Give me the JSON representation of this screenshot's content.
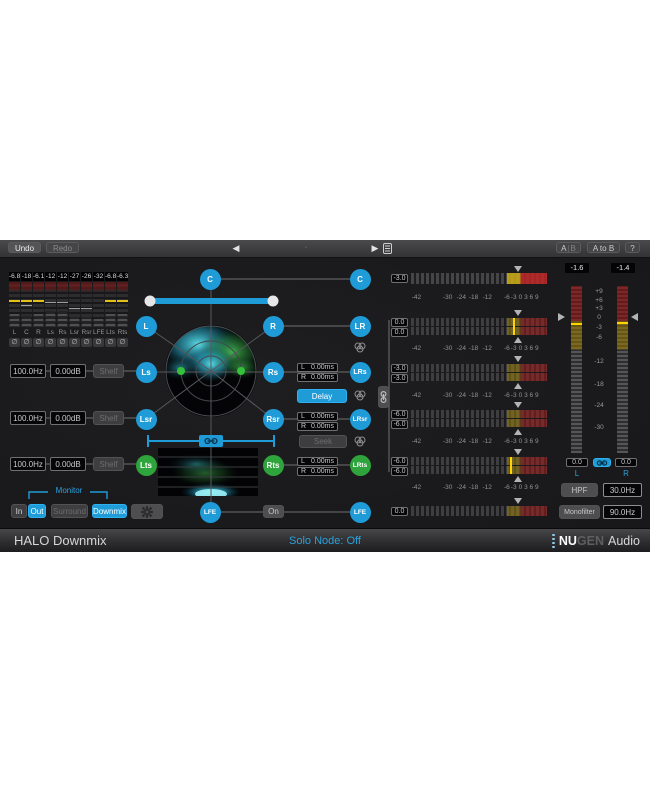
{
  "topbar": {
    "undo": "Undo",
    "redo": "Redo",
    "prev_icon": "◀",
    "dot": "·",
    "play_icon": "▶",
    "ab_a": "A",
    "ab_sep": "|",
    "ab_b": "B",
    "a_to_b": "A to B",
    "help": "?"
  },
  "input_meters": {
    "channels": [
      {
        "label": "L",
        "peak": "-6.8",
        "phase": "∅"
      },
      {
        "label": "C",
        "peak": "-18",
        "phase": "∅"
      },
      {
        "label": "R",
        "peak": "-6.1",
        "phase": "∅"
      },
      {
        "label": "Ls",
        "peak": "-12",
        "phase": "∅"
      },
      {
        "label": "Rs",
        "peak": "-12",
        "phase": "∅"
      },
      {
        "label": "Lsr",
        "peak": "-27",
        "phase": "∅"
      },
      {
        "label": "Rsr",
        "peak": "-26",
        "phase": "∅"
      },
      {
        "label": "LFE",
        "peak": "-32",
        "phase": "∅"
      },
      {
        "label": "Lts",
        "peak": "-6.8",
        "phase": "∅"
      },
      {
        "label": "Rts",
        "peak": "-6.3",
        "phase": "∅"
      }
    ]
  },
  "shelf_rows": [
    {
      "freq": "100.0Hz",
      "gain": "0.00dB",
      "mode": "Shelf"
    },
    {
      "freq": "100.0Hz",
      "gain": "0.00dB",
      "mode": "Shelf"
    },
    {
      "freq": "100.0Hz",
      "gain": "0.00dB",
      "mode": "Shelf"
    }
  ],
  "monitor": {
    "label": "Monitor",
    "in": "In",
    "out": "Out",
    "surround": "Surround",
    "downmix": "Downmix"
  },
  "nodes": {
    "c_in": "C",
    "l": "L",
    "r": "R",
    "ls": "Ls",
    "rs": "Rs",
    "lsr": "Lsr",
    "rsr": "Rsr",
    "lts": "Lts",
    "rts": "Rts",
    "lfe_in": "LFE",
    "c_out": "C",
    "lr": "LR",
    "lrs": "LRs",
    "lrsr": "LRsr",
    "lrts": "LRts",
    "lfe_out": "LFE"
  },
  "delay": {
    "rows": [
      {
        "l_ch": "L",
        "l_val": "0.00ms",
        "r_ch": "R",
        "r_val": "0.00ms"
      },
      {
        "l_ch": "L",
        "l_val": "0.00ms",
        "r_ch": "R",
        "r_val": "0.00ms"
      },
      {
        "l_ch": "L",
        "l_val": "0.00ms",
        "r_ch": "R",
        "r_val": "0.00ms"
      }
    ],
    "delay_btn": "Delay",
    "seek_btn": "Seek"
  },
  "lfe_on": "On",
  "downmix_meters": {
    "scale": [
      "-42",
      "-30",
      "-24",
      "-18",
      "-12",
      "-6",
      "-3",
      "0",
      "3",
      "6",
      "9"
    ],
    "c_gain": "-3.0",
    "lr_l": "0.0",
    "lr_r": "0.0",
    "lrs_l": "-3.0",
    "lrs_r": "-3.0",
    "lrsr_l": "-6.0",
    "lrsr_r": "-6.0",
    "lrts_l": "-6.0",
    "lrts_r": "-6.0",
    "lfe_gain": "0.0"
  },
  "master": {
    "peak_l": "-1.6",
    "peak_r": "-1.4",
    "scale": [
      "+9",
      "+6",
      "+3",
      "0",
      "-3",
      "-6",
      "-12",
      "-18",
      "-24",
      "-30"
    ],
    "trim_l": "0.0",
    "trim_r": "0.0",
    "label_l": "L",
    "label_r": "R",
    "hpf": "HPF",
    "hpf_freq": "30.0Hz",
    "monofilter": "Monofilter",
    "monofilter_freq": "90.0Hz"
  },
  "statusbar": {
    "title": "HALO Downmix",
    "solo": "Solo Node: Off",
    "brand_nu": "NU",
    "brand_gen": "GEN",
    "brand_audio": "Audio"
  },
  "colors": {
    "accent": "#1f9bd8",
    "green": "#2fa33c",
    "peak_yellow": "#ffd400"
  }
}
